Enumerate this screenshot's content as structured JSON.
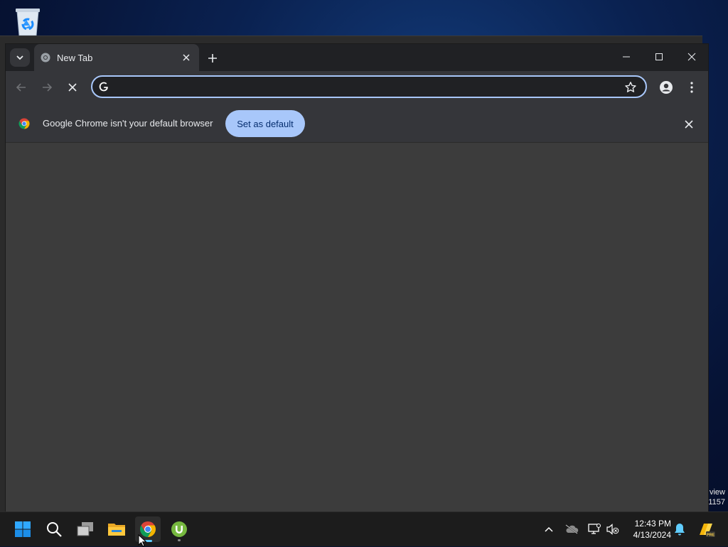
{
  "desktop": {
    "watermark_line1": "view",
    "watermark_line2": "1157"
  },
  "browser": {
    "tab": {
      "title": "New Tab"
    },
    "omnibox": {
      "value": "",
      "placeholder": ""
    },
    "infobar": {
      "message": "Google Chrome isn't your default browser",
      "button_label": "Set as default"
    }
  },
  "taskbar": {
    "items": [
      "start-icon",
      "search-icon",
      "task-view-icon",
      "file-explorer-icon",
      "chrome-icon",
      "utorrent-icon"
    ],
    "clock": {
      "time": "12:43 PM",
      "date": "4/13/2024"
    }
  },
  "colors": {
    "accent": "#a8c7fa",
    "taskbar_accent": "#60cdff",
    "chrome_dark": "#202124",
    "chrome_toolbar": "#35363a"
  }
}
